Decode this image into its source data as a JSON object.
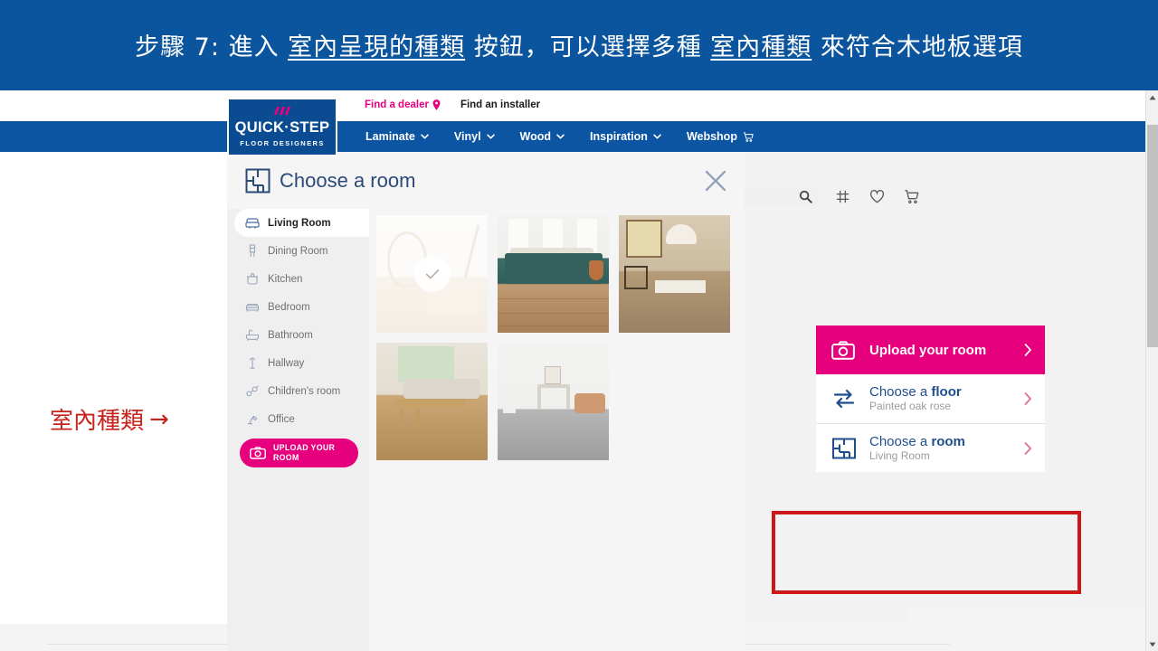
{
  "annotation_banner": {
    "prefix": "步驟 7:  進入 ",
    "underline1": "室內呈現的種類",
    "mid": " 按鈕，可以選擇多種 ",
    "underline2": "室內種類",
    "suffix": " 來符合木地板選項",
    "bg_color": "#0b559e",
    "text_color": "#ffffff"
  },
  "left_annotation": {
    "text": "室內種類",
    "arrow": "→",
    "color": "#c7231c"
  },
  "site": {
    "logo": {
      "name": "QUICK·STEP",
      "tagline": "FLOOR DESIGNERS",
      "accent_color": "#e6007e",
      "bg_color": "#0b4b91"
    },
    "utility_bar": {
      "find_dealer": "Find a dealer",
      "find_installer": "Find an installer",
      "search_placeholder": "Search",
      "search_value": "",
      "icons": [
        "search-icon",
        "compare-icon",
        "wishlist-heart-icon",
        "cart-icon"
      ]
    },
    "nav": {
      "bg_color": "#0b55a3",
      "items": [
        {
          "label": "Laminate",
          "has_caret": true
        },
        {
          "label": "Vinyl",
          "has_caret": true
        },
        {
          "label": "Wood",
          "has_caret": true
        },
        {
          "label": "Inspiration",
          "has_caret": true
        },
        {
          "label": "Webshop",
          "has_caret": false,
          "has_cart": true
        }
      ]
    }
  },
  "modal": {
    "title": "Choose a room",
    "icon": "floorplan-icon",
    "close_label": "×",
    "rooms": [
      {
        "label": "Living Room",
        "icon": "sofa-icon",
        "active": true
      },
      {
        "label": "Dining Room",
        "icon": "chair-icon",
        "active": false
      },
      {
        "label": "Kitchen",
        "icon": "pot-icon",
        "active": false
      },
      {
        "label": "Bedroom",
        "icon": "bed-icon",
        "active": false
      },
      {
        "label": "Bathroom",
        "icon": "bathtub-icon",
        "active": false
      },
      {
        "label": "Hallway",
        "icon": "coatrack-icon",
        "active": false
      },
      {
        "label": "Children's room",
        "icon": "toy-icon",
        "active": false
      },
      {
        "label": "Office",
        "icon": "desklamp-icon",
        "active": false
      }
    ],
    "upload_button": {
      "line1": "UPLOAD YOUR",
      "line2": "ROOM",
      "icon": "camera-icon",
      "color": "#e6007e"
    },
    "thumbnails": [
      {
        "id": "thumb-1",
        "selected": true,
        "alt": "Light living room with hanging chair"
      },
      {
        "id": "thumb-2",
        "selected": false,
        "alt": "Living room with green sofa"
      },
      {
        "id": "thumb-3",
        "selected": false,
        "alt": "Living room with pendant lamp and coffee table"
      },
      {
        "id": "thumb-4",
        "selected": false,
        "alt": "Living room with wooden bench by window"
      },
      {
        "id": "thumb-5",
        "selected": false,
        "alt": "Living room with fireplace and leather couch"
      }
    ]
  },
  "actions": {
    "upload": {
      "label": "Upload your room",
      "icon": "camera-icon",
      "chevron": "›",
      "bg_color": "#e6007e"
    },
    "choose_floor": {
      "title_prefix": "Choose a ",
      "title_strong": "floor",
      "subtitle": "Painted oak rose",
      "icon": "swap-arrows-icon",
      "chevron": "›"
    },
    "choose_room": {
      "title_prefix": "Choose a ",
      "title_strong": "room",
      "subtitle": "Living Room",
      "icon": "floorplan-icon",
      "chevron": "›",
      "highlighted": true,
      "highlight_color": "#d01818"
    }
  },
  "scrollbar": {
    "up_arrow": "▲",
    "down_arrow": "▼"
  }
}
